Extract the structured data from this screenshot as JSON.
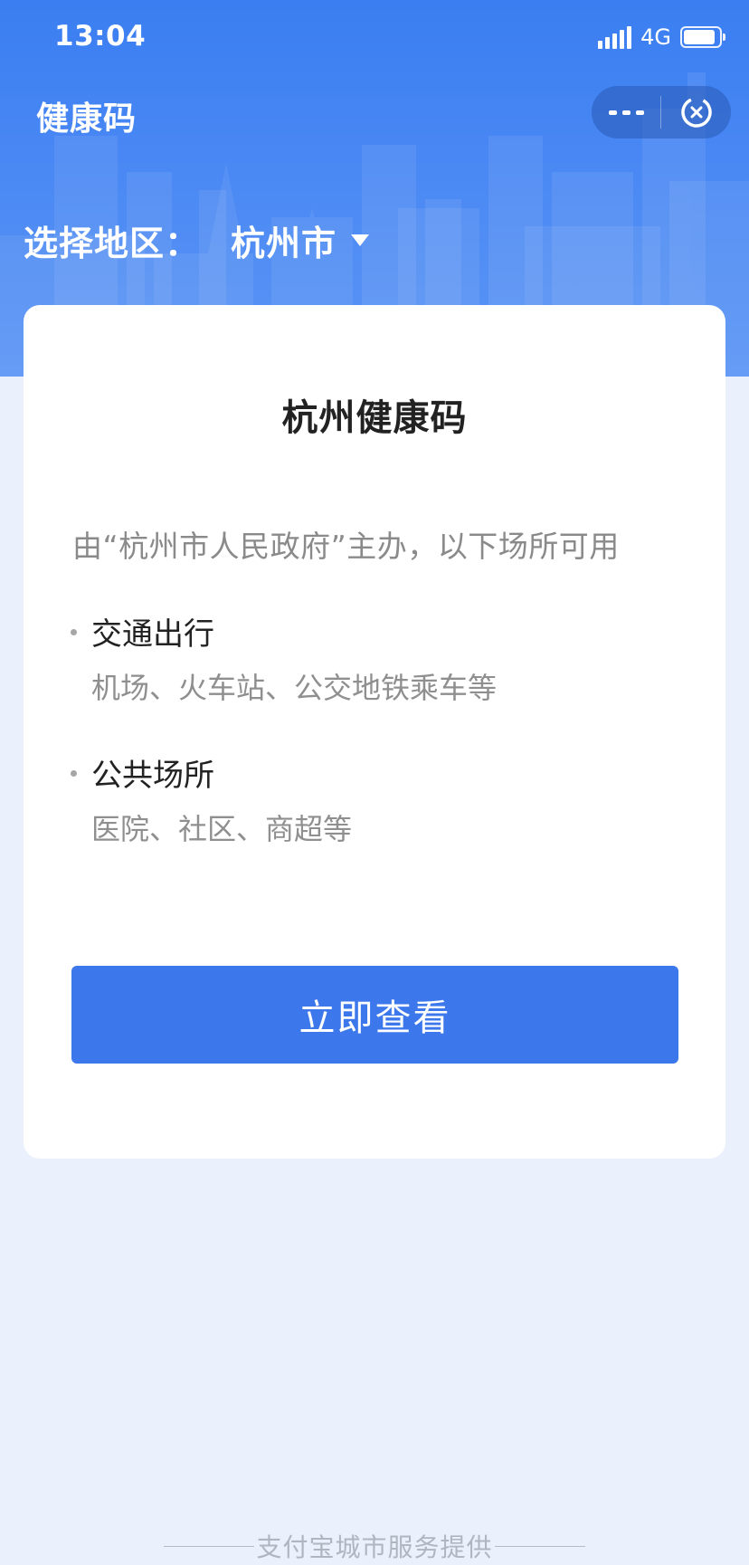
{
  "status_bar": {
    "time": "13:04",
    "network": "4G"
  },
  "header": {
    "title": "健康码"
  },
  "region": {
    "label": "选择地区：",
    "value": "杭州市"
  },
  "card": {
    "title": "杭州健康码",
    "description": "由“杭州市人民政府”主办，以下场所可用",
    "venues": [
      {
        "title": "交通出行",
        "detail": "机场、火车站、公交地铁乘车等"
      },
      {
        "title": "公共场所",
        "detail": "医院、社区、商超等"
      }
    ],
    "button_label": "立即查看"
  },
  "footer": {
    "text": "支付宝城市服务提供"
  },
  "colors": {
    "primary": "#3c78ec",
    "hero_top": "#3a7ef1",
    "page_bg": "#eaf1fd"
  },
  "icons": {
    "more": "more-dots-icon",
    "close": "close-circle-icon",
    "caret": "caret-down-icon"
  }
}
